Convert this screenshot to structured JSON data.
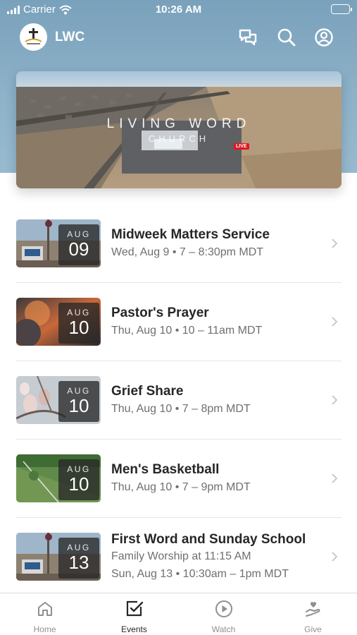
{
  "status_bar": {
    "carrier": "Carrier",
    "time": "10:26 AM"
  },
  "header": {
    "app_name": "LWC",
    "icons": [
      "chat-icon",
      "search-icon",
      "account-icon"
    ]
  },
  "hero": {
    "title": "LIVING WORD",
    "subtitle": "CHURCH",
    "badge": "LIVE"
  },
  "events": [
    {
      "month": "AUG",
      "day": "09",
      "title": "Midweek Matters Service",
      "lines": [
        "Wed, Aug 9 • 7 – 8:30pm MDT"
      ]
    },
    {
      "month": "AUG",
      "day": "10",
      "title": "Pastor's Prayer",
      "lines": [
        "Thu, Aug 10 • 10 – 11am MDT"
      ]
    },
    {
      "month": "AUG",
      "day": "10",
      "title": "Grief Share",
      "lines": [
        "Thu, Aug 10 • 7 – 8pm MDT"
      ]
    },
    {
      "month": "AUG",
      "day": "10",
      "title": "Men's Basketball",
      "lines": [
        "Thu, Aug 10 • 7 – 9pm MDT"
      ]
    },
    {
      "month": "AUG",
      "day": "13",
      "title": "First Word and Sunday School",
      "lines": [
        "Family Worship at 11:15 AM",
        "Sun, Aug 13 • 10:30am – 1pm MDT"
      ]
    }
  ],
  "tabs": [
    {
      "label": "Home",
      "icon": "home-icon"
    },
    {
      "label": "Events",
      "icon": "calendar-check-icon",
      "active": true
    },
    {
      "label": "Watch",
      "icon": "play-icon"
    },
    {
      "label": "Give",
      "icon": "give-hand-heart-icon"
    }
  ],
  "colors": {
    "header_bg": "#8db2c9",
    "live_badge": "#e0161e",
    "active_tab": "#262626",
    "inactive_tab": "#8f8f8f"
  }
}
